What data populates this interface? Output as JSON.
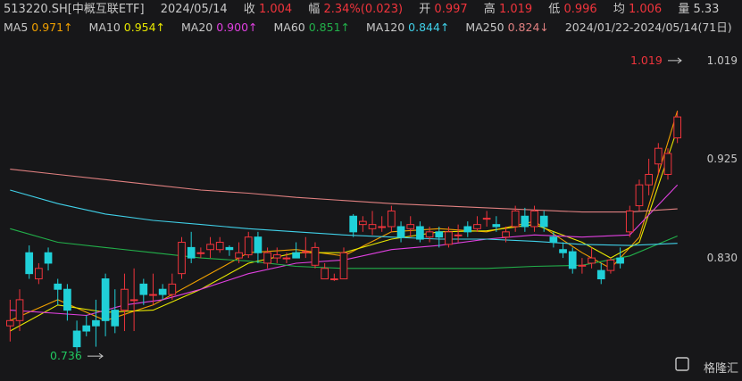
{
  "header": {
    "symbol": "513220.SH[中概互联ETF]",
    "date": "2024/05/14",
    "close_label": "收",
    "close_value": "1.004",
    "change_label": "幅",
    "change_value": "2.34%(0.023)",
    "open_label": "开",
    "open_value": "0.997",
    "high_label": "高",
    "high_value": "1.019",
    "low_label": "低",
    "low_value": "0.996",
    "avg_label": "均",
    "avg_value": "1.006",
    "vol_label": "量",
    "vol_value": "5.33"
  },
  "ma_legend": [
    {
      "label": "MA5",
      "value": "0.971↑",
      "color": "#f0a000"
    },
    {
      "label": "MA10",
      "value": "0.954↑",
      "color": "#e8e800"
    },
    {
      "label": "MA20",
      "value": "0.900↑",
      "color": "#e040e0"
    },
    {
      "label": "MA60",
      "value": "0.851↑",
      "color": "#22b04a"
    },
    {
      "label": "MA120",
      "value": "0.844↑",
      "color": "#40d0e8"
    },
    {
      "label": "MA250",
      "value": "0.824↓",
      "color": "#e08080"
    }
  ],
  "range_text": "2024/01/22-2024/05/14(71日)",
  "watermark": "格隆汇",
  "colors": {
    "up": "#f0343c",
    "down": "#20d0d8",
    "bg": "#171719"
  },
  "chart_data": {
    "type": "candlestick",
    "ylim": [
      0.725,
      1.03
    ],
    "y_ticks": [
      1.019,
      0.925,
      0.83
    ],
    "annotations": [
      {
        "text": "1.019",
        "value": 1.019,
        "kind": "high"
      },
      {
        "text": "0.736",
        "value": 0.736,
        "kind": "low"
      }
    ],
    "candles": [
      [
        0.765,
        0.77,
        0.79,
        0.75
      ],
      [
        0.77,
        0.79,
        0.8,
        0.76
      ],
      [
        0.835,
        0.815,
        0.842,
        0.81
      ],
      [
        0.81,
        0.82,
        0.825,
        0.805
      ],
      [
        0.835,
        0.825,
        0.84,
        0.818
      ],
      [
        0.805,
        0.8,
        0.81,
        0.785
      ],
      [
        0.8,
        0.78,
        0.805,
        0.77
      ],
      [
        0.76,
        0.745,
        0.77,
        0.74
      ],
      [
        0.765,
        0.76,
        0.775,
        0.755
      ],
      [
        0.77,
        0.765,
        0.79,
        0.745
      ],
      [
        0.81,
        0.77,
        0.815,
        0.755
      ],
      [
        0.78,
        0.765,
        0.8,
        0.758
      ],
      [
        0.78,
        0.8,
        0.815,
        0.76
      ],
      [
        0.79,
        0.79,
        0.82,
        0.76
      ],
      [
        0.805,
        0.795,
        0.81,
        0.785
      ],
      [
        0.795,
        0.795,
        0.815,
        0.785
      ],
      [
        0.8,
        0.795,
        0.805,
        0.79
      ],
      [
        0.795,
        0.805,
        0.815,
        0.79
      ],
      [
        0.815,
        0.845,
        0.85,
        0.81
      ],
      [
        0.84,
        0.83,
        0.855,
        0.825
      ],
      [
        0.835,
        0.835,
        0.84,
        0.83
      ],
      [
        0.838,
        0.843,
        0.85,
        0.83
      ],
      [
        0.838,
        0.845,
        0.85,
        0.835
      ],
      [
        0.84,
        0.838,
        0.842,
        0.832
      ],
      [
        0.83,
        0.835,
        0.845,
        0.825
      ],
      [
        0.833,
        0.85,
        0.855,
        0.83
      ],
      [
        0.85,
        0.835,
        0.855,
        0.825
      ],
      [
        0.825,
        0.835,
        0.84,
        0.82
      ],
      [
        0.83,
        0.833,
        0.84,
        0.825
      ],
      [
        0.83,
        0.83,
        0.835,
        0.825
      ],
      [
        0.835,
        0.83,
        0.845,
        0.83
      ],
      [
        0.836,
        0.836,
        0.85,
        0.83
      ],
      [
        0.823,
        0.84,
        0.845,
        0.82
      ],
      [
        0.81,
        0.82,
        0.825,
        0.81
      ],
      [
        0.81,
        0.81,
        0.815,
        0.808
      ],
      [
        0.81,
        0.835,
        0.84,
        0.81
      ],
      [
        0.87,
        0.855,
        0.872,
        0.85
      ],
      [
        0.862,
        0.865,
        0.87,
        0.855
      ],
      [
        0.858,
        0.862,
        0.875,
        0.852
      ],
      [
        0.86,
        0.86,
        0.87,
        0.855
      ],
      [
        0.86,
        0.875,
        0.88,
        0.855
      ],
      [
        0.86,
        0.85,
        0.865,
        0.845
      ],
      [
        0.858,
        0.862,
        0.87,
        0.85
      ],
      [
        0.86,
        0.848,
        0.865,
        0.845
      ],
      [
        0.85,
        0.855,
        0.86,
        0.845
      ],
      [
        0.855,
        0.85,
        0.86,
        0.84
      ],
      [
        0.843,
        0.855,
        0.86,
        0.84
      ],
      [
        0.852,
        0.852,
        0.862,
        0.845
      ],
      [
        0.86,
        0.855,
        0.865,
        0.85
      ],
      [
        0.858,
        0.862,
        0.87,
        0.855
      ],
      [
        0.868,
        0.868,
        0.875,
        0.86
      ],
      [
        0.862,
        0.86,
        0.87,
        0.855
      ],
      [
        0.85,
        0.855,
        0.86,
        0.845
      ],
      [
        0.86,
        0.875,
        0.88,
        0.855
      ],
      [
        0.87,
        0.86,
        0.878,
        0.855
      ],
      [
        0.86,
        0.875,
        0.88,
        0.855
      ],
      [
        0.87,
        0.86,
        0.875,
        0.855
      ],
      [
        0.85,
        0.845,
        0.855,
        0.84
      ],
      [
        0.838,
        0.835,
        0.845,
        0.83
      ],
      [
        0.836,
        0.82,
        0.84,
        0.815
      ],
      [
        0.823,
        0.823,
        0.83,
        0.815
      ],
      [
        0.825,
        0.83,
        0.84,
        0.82
      ],
      [
        0.818,
        0.81,
        0.825,
        0.805
      ],
      [
        0.818,
        0.828,
        0.83,
        0.815
      ],
      [
        0.83,
        0.825,
        0.84,
        0.82
      ],
      [
        0.855,
        0.875,
        0.88,
        0.85
      ],
      [
        0.88,
        0.9,
        0.905,
        0.875
      ],
      [
        0.9,
        0.91,
        0.925,
        0.89
      ],
      [
        0.92,
        0.935,
        0.94,
        0.91
      ],
      [
        0.91,
        0.93,
        0.935,
        0.905
      ],
      [
        0.945,
        0.965,
        0.97,
        0.94
      ]
    ],
    "ma": [
      {
        "label": "MA5",
        "points": [
          [
            0,
            0.77
          ],
          [
            5,
            0.79
          ],
          [
            10,
            0.77
          ],
          [
            15,
            0.785
          ],
          [
            20,
            0.81
          ],
          [
            25,
            0.835
          ],
          [
            30,
            0.838
          ],
          [
            35,
            0.832
          ],
          [
            40,
            0.855
          ],
          [
            45,
            0.858
          ],
          [
            50,
            0.855
          ],
          [
            55,
            0.865
          ],
          [
            60,
            0.835
          ],
          [
            63,
            0.82
          ],
          [
            66,
            0.85
          ],
          [
            70,
            0.971
          ]
        ]
      },
      {
        "label": "MA10",
        "points": [
          [
            0,
            0.76
          ],
          [
            5,
            0.785
          ],
          [
            10,
            0.778
          ],
          [
            15,
            0.78
          ],
          [
            20,
            0.8
          ],
          [
            25,
            0.825
          ],
          [
            30,
            0.835
          ],
          [
            35,
            0.835
          ],
          [
            40,
            0.848
          ],
          [
            45,
            0.855
          ],
          [
            50,
            0.856
          ],
          [
            55,
            0.862
          ],
          [
            60,
            0.845
          ],
          [
            63,
            0.83
          ],
          [
            66,
            0.845
          ],
          [
            70,
            0.954
          ]
        ]
      },
      {
        "label": "MA20",
        "points": [
          [
            0,
            0.78
          ],
          [
            8,
            0.775
          ],
          [
            12,
            0.785
          ],
          [
            16,
            0.79
          ],
          [
            20,
            0.8
          ],
          [
            25,
            0.815
          ],
          [
            30,
            0.825
          ],
          [
            35,
            0.828
          ],
          [
            40,
            0.838
          ],
          [
            45,
            0.842
          ],
          [
            50,
            0.848
          ],
          [
            55,
            0.852
          ],
          [
            60,
            0.85
          ],
          [
            65,
            0.852
          ],
          [
            70,
            0.9
          ]
        ]
      },
      {
        "label": "MA60",
        "points": [
          [
            0,
            0.858
          ],
          [
            5,
            0.845
          ],
          [
            10,
            0.84
          ],
          [
            15,
            0.835
          ],
          [
            20,
            0.83
          ],
          [
            25,
            0.827
          ],
          [
            30,
            0.822
          ],
          [
            35,
            0.82
          ],
          [
            40,
            0.82
          ],
          [
            45,
            0.82
          ],
          [
            50,
            0.82
          ],
          [
            55,
            0.822
          ],
          [
            60,
            0.823
          ],
          [
            65,
            0.832
          ],
          [
            70,
            0.851
          ]
        ]
      },
      {
        "label": "MA120",
        "points": [
          [
            0,
            0.895
          ],
          [
            5,
            0.882
          ],
          [
            10,
            0.872
          ],
          [
            15,
            0.866
          ],
          [
            20,
            0.862
          ],
          [
            25,
            0.858
          ],
          [
            30,
            0.855
          ],
          [
            35,
            0.852
          ],
          [
            40,
            0.85
          ],
          [
            45,
            0.848
          ],
          [
            50,
            0.848
          ],
          [
            55,
            0.846
          ],
          [
            60,
            0.843
          ],
          [
            65,
            0.842
          ],
          [
            70,
            0.844
          ]
        ]
      },
      {
        "label": "MA250",
        "points": [
          [
            0,
            0.915
          ],
          [
            5,
            0.91
          ],
          [
            10,
            0.905
          ],
          [
            15,
            0.9
          ],
          [
            20,
            0.895
          ],
          [
            25,
            0.892
          ],
          [
            30,
            0.888
          ],
          [
            35,
            0.885
          ],
          [
            40,
            0.882
          ],
          [
            45,
            0.88
          ],
          [
            50,
            0.878
          ],
          [
            55,
            0.876
          ],
          [
            60,
            0.874
          ],
          [
            65,
            0.874
          ],
          [
            70,
            0.877
          ]
        ]
      }
    ]
  }
}
